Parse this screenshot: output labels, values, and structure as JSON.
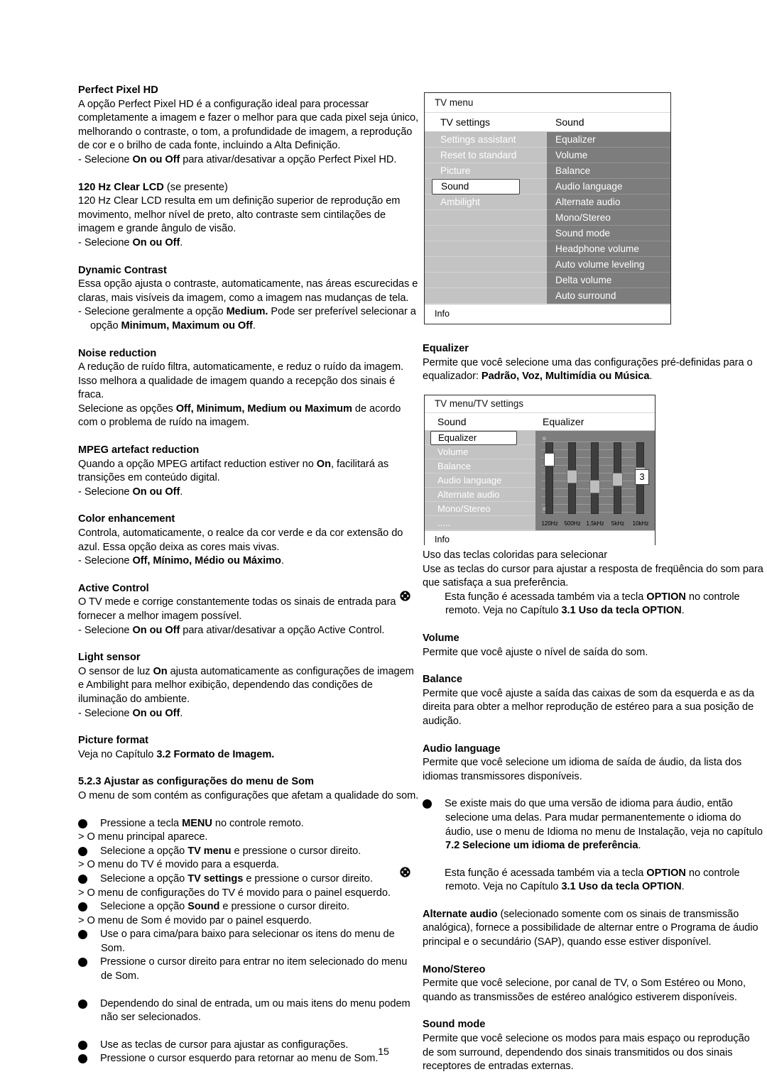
{
  "page": {
    "number": "15"
  },
  "left_column": {
    "sections": [
      {
        "heading": "Perfect Pixel HD",
        "body": "A opção Perfect Pixel HD é a configuração ideal para processar completamente a imagem e fazer o melhor para que cada pixel seja único, melhorando o contraste, o tom, a profundidade de imagem, a reprodução de cor e o brilho de cada fonte, incluindo a Alta Definição.",
        "bullet_pre": "- Selecione ",
        "bullet_bold": "On ou Off",
        "bullet_post": " para ativar/desativar a opção Perfect Pixel HD."
      },
      {
        "heading": "120 Hz Clear LCD",
        "heading_suffix": " (se presente)",
        "body": "120 Hz Clear LCD resulta em um definição superior de reprodução em movimento, melhor nível de preto, alto contraste sem cintilações de imagem e grande ângulo de visão.",
        "bullet_pre": "- Selecione  ",
        "bullet_bold": "On ou Off",
        "bullet_post": "."
      },
      {
        "heading": "Dynamic Contrast",
        "body": "Essa opção ajusta o contraste, automaticamente, nas áreas escurecidas e claras, mais visíveis da imagem, como a imagem nas mudanças de tela.",
        "bullet_pre": "- Selecione geralmente a opção ",
        "bullet_bold": "Medium.",
        "bullet_post": " Pode ser preferível selecionar a opção ",
        "bullet_bold2": "Minimum, Maximum ou Off",
        "bullet_post2": "."
      },
      {
        "heading": "Noise reduction",
        "body": "A redução de ruído filtra, automaticamente, e reduz o ruído da imagem.",
        "body2": "Isso melhora a qualidade de imagem quando a recepção dos sinais é fraca.",
        "body3_pre": "Selecione as opções ",
        "body3_bold": "Off, Minimum, Medium ou Maximum",
        "body3_post": " de acordo com o problema de ruído na imagem."
      },
      {
        "heading": "MPEG artefact reduction",
        "body_pre": "Quando a opção MPEG artifact reduction estiver no ",
        "body_bold": "On",
        "body_post": ", facilitará as transições em conteúdo digital.",
        "bullet_pre": "- Selecione ",
        "bullet_bold": "On ou Off",
        "bullet_post": "."
      },
      {
        "heading": "Color enhancement",
        "body": "Controla, automaticamente, o realce da cor verde e da cor extensão do azul. Essa opção deixa as cores mais vivas.",
        "bullet_pre": "- Selecione ",
        "bullet_bold": "Off, Mínimo, Médio ou Máximo",
        "bullet_post": "."
      },
      {
        "heading": "Active Control",
        "body": "O TV mede e corrige constantemente todas os sinais de entrada para fornecer a melhor imagem possível.",
        "bullet_pre": "- Selecione ",
        "bullet_bold": "On ou Off",
        "bullet_post": " para ativar/desativar a opção Active Control."
      },
      {
        "heading": "Light sensor",
        "body_pre": "O sensor de luz ",
        "body_bold": "On",
        "body_post": " ajusta automaticamente as configurações de imagem e Ambilight para melhor exibição, dependendo das condições de iluminação do ambiente.",
        "bullet_pre": "- Selecione ",
        "bullet_bold": "On ou Off",
        "bullet_post": "."
      },
      {
        "heading": "Picture format",
        "body_pre": "Veja no Capítulo ",
        "body_bold": "3.2 Formato de Imagem."
      }
    ],
    "subsection": {
      "heading": "5.2.3  Ajustar as configurações do menu de Som",
      "intro": "O menu de som contém as configurações que afetam a qualidade do som."
    },
    "steps": [
      {
        "num": "❶",
        "pre": "Pressione a tecla ",
        "bold": "MENU",
        "post": " no controle remoto."
      },
      {
        "arrow": "> ",
        "text": "O menu principal aparece."
      },
      {
        "num": "❷",
        "pre": "Selecione a opção ",
        "bold": "TV menu",
        "post": " e pressione o cursor direito."
      },
      {
        "arrow": "> ",
        "text": "O menu do TV é movido para a esquerda."
      },
      {
        "num": "❸",
        "pre": "Selecione a opção ",
        "bold": "TV settings",
        "post": " e pressione o cursor direito."
      },
      {
        "arrow": "> ",
        "text": "O menu de configurações do TV é movido para o painel esquerdo."
      },
      {
        "num": "❹",
        "pre": "Selecione a opção ",
        "bold": "Sound",
        "post": " e pressione o cursor direito."
      },
      {
        "arrow": "> ",
        "text": "O menu de Som é movido par o painel esquerdo."
      },
      {
        "num": "❺",
        "pre": "Use o para cima/para baixo para selecionar os itens do menu de Som.",
        "bold": "",
        "post": ""
      },
      {
        "num": "❻",
        "pre": "Pressione o cursor direito para entrar no item selecionado do menu de Som.",
        "bold": "",
        "post": ""
      }
    ],
    "note": "Dependendo do sinal de entrada, um ou mais itens do menu podem não ser selecionados.",
    "steps_after": [
      {
        "num": "❼",
        "pre": "Use as teclas de cursor para ajustar as configurações.",
        "bold": "",
        "post": ""
      },
      {
        "num": "❽",
        "pre": "Pressione o cursor esquerdo para retornar ao menu de Som.",
        "bold": "",
        "post": ""
      }
    ]
  },
  "right_column": {
    "sections": [
      {
        "heading": "Equalizer",
        "body_pre": "Permite que você selecione uma das configurações pré-definidas para o equalizador: ",
        "body_bold": "Padrão, Voz, Multimídia ou Música",
        "body_post": "."
      }
    ],
    "after_eq": {
      "line1": "Uso das teclas coloridas para selecionar",
      "line2": "Use as teclas do cursor para ajustar a resposta de freqüência do som para que satisfaça a sua preferência.",
      "option_note_pre": "Esta função é acessada também via a tecla ",
      "option_note_bold": "OPTION",
      "option_note_mid": " no controle remoto. Veja no Capítulo ",
      "option_note_bold2": "3.1 Uso da tecla OPTION",
      "option_note_post": "."
    },
    "sections2": [
      {
        "heading": "Volume",
        "body": "Permite que você ajuste o nível de saída do som."
      },
      {
        "heading": "Balance",
        "body": "Permite que você ajuste a saída das caixas de som da esquerda e as da direita para obter a melhor reprodução de estéreo para a sua posição de audição."
      },
      {
        "heading": "Audio language",
        "body": "Permite que você selecione um idioma de saída de áudio, da lista dos idiomas transmissores disponíveis."
      }
    ],
    "audio_note": {
      "pre": "Se existe mais do que uma versão de idioma para áudio, então selecione uma delas. Para mudar permanentemente o idioma do áudio, use o menu de Idioma no menu de Instalação, veja no capítulo ",
      "bold": "7.2 Selecione um idioma de preferência",
      "post": "."
    },
    "option_note2": {
      "pre": "Esta função é acessada também via a tecla ",
      "bold": "OPTION",
      "mid": " no controle remoto. Veja no Capítulo ",
      "bold2": "3.1 Uso da tecla OPTION",
      "post": "."
    },
    "alternate_audio": {
      "bold": "Alternate audio",
      "text": " (selecionado somente com os sinais de transmissão analógica), fornece a possibilidade de alternar entre o Programa de áudio principal e o secundário (SAP), quando esse estiver disponível."
    },
    "sections3": [
      {
        "heading": "Mono/Stereo",
        "body": "Permite que você selecione, por canal de TV, o Som Estéreo ou Mono, quando as transmissões de estéreo analógico estiverem disponíveis."
      },
      {
        "heading": "Sound mode",
        "body": "Permite que você selecione os modos para mais espaço ou reprodução de som surround, dependendo dos sinais transmitidos ou dos sinais receptores de entradas externas."
      }
    ]
  },
  "tv_menu_1": {
    "title": "TV menu",
    "col1_header": "TV settings",
    "col2_header": "Sound",
    "left_items": [
      "Settings assistant",
      "Reset to standard",
      "Picture",
      "Sound",
      "Ambilight"
    ],
    "left_selected": "Sound",
    "right_items": [
      "Equalizer",
      "Volume",
      "Balance",
      "Audio language",
      "Alternate audio",
      "Mono/Stereo",
      "Sound mode",
      "Headphone volume",
      "Auto volume leveling",
      "Delta volume",
      "Auto surround"
    ],
    "info": "Info"
  },
  "tv_menu_2": {
    "title": "TV menu/TV settings",
    "col1_header": "Sound",
    "col2_header": "Equalizer",
    "left_items": [
      "Equalizer",
      "Volume",
      "Balance",
      "Audio language",
      "Alternate audio",
      "Mono/Stereo",
      "....."
    ],
    "left_selected": "Equalizer",
    "info": "Info",
    "equalizer": {
      "scale_top": "o",
      "scale_bottom": "oe",
      "value": "3",
      "bands": [
        {
          "label": "120Hz",
          "position_pct": 22,
          "active": true
        },
        {
          "label": "500Hz",
          "position_pct": 46,
          "active": false
        },
        {
          "label": "1,5kHz",
          "position_pct": 60,
          "active": false
        },
        {
          "label": "5kHz",
          "position_pct": 50,
          "active": false
        },
        {
          "label": "10kHz",
          "position_pct": 44,
          "active": false
        }
      ]
    }
  },
  "colors": {
    "menu_left_bg": "#c3c3c3",
    "menu_right_bg": "#7d7d7d",
    "menu_text": "#ffffff",
    "selected_bg": "#ffffff",
    "selected_text": "#000000"
  }
}
